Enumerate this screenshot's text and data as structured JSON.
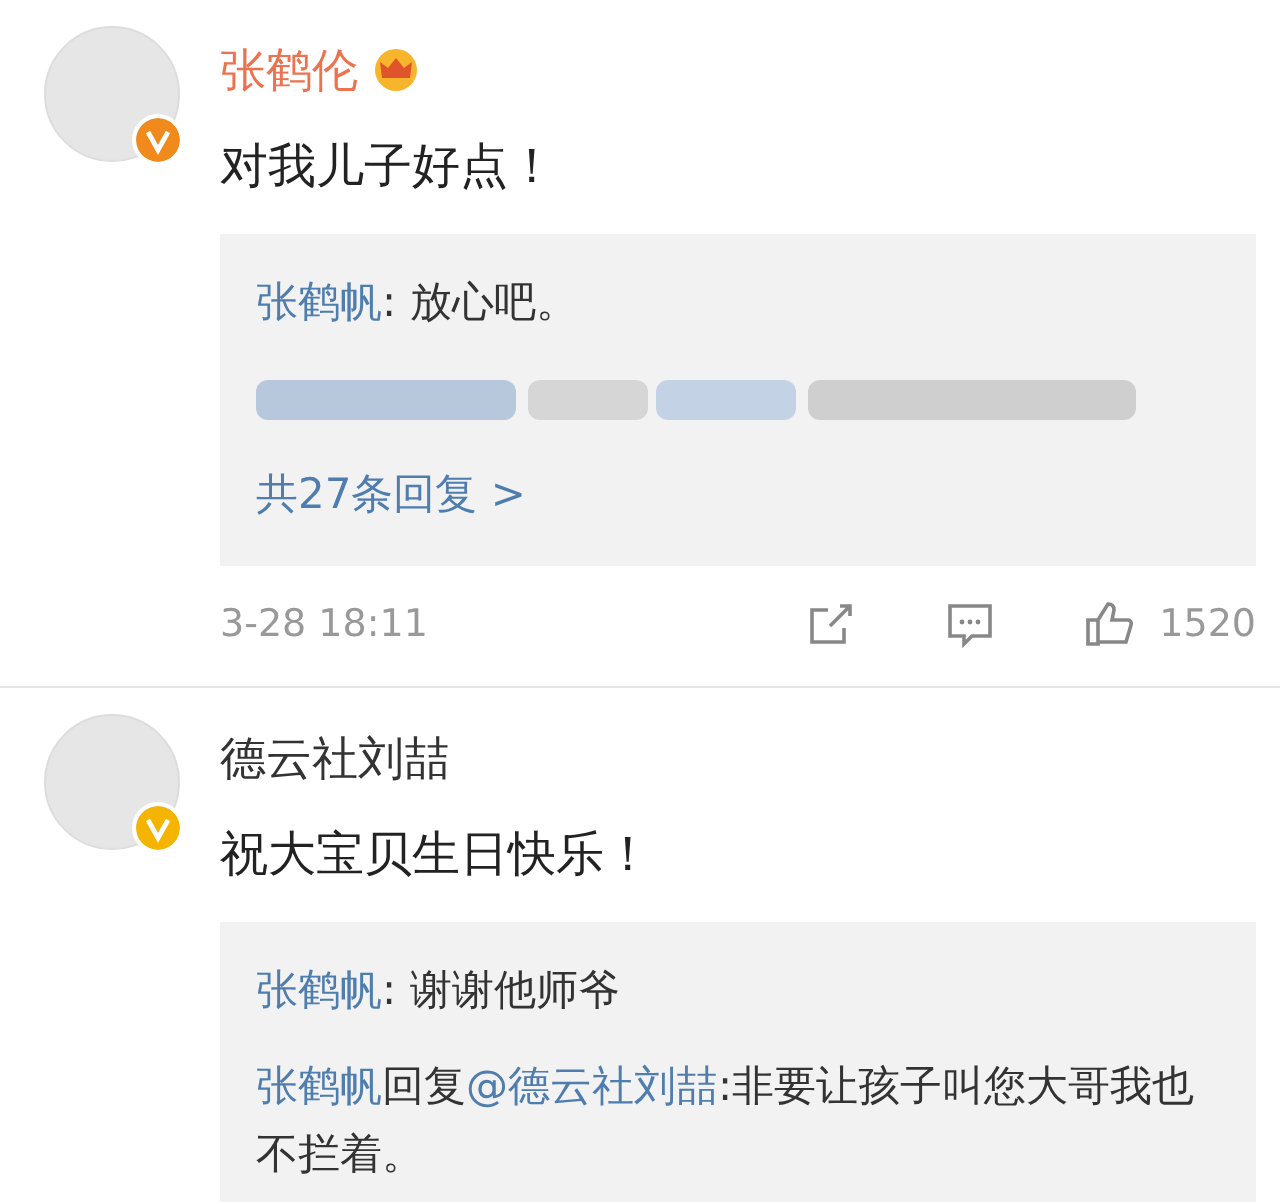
{
  "comments": [
    {
      "author": "张鹤伦",
      "vip": true,
      "color": "#f08a1c",
      "text": "对我儿子好点！",
      "replies": [
        {
          "kind": "reply",
          "author": "张鹤帆",
          "text": ": 放心吧。"
        },
        {
          "kind": "blurred"
        }
      ],
      "more": "共27条回复 >",
      "time": "3-28 18:11",
      "likes": "1520"
    },
    {
      "author": "德云社刘喆",
      "vip": false,
      "color": "#f5b400",
      "text": "祝大宝贝生日快乐！",
      "replies": [
        {
          "kind": "reply",
          "author": "张鹤帆",
          "text": ": 谢谢他师爷"
        },
        {
          "kind": "reply",
          "author": "张鹤帆",
          "prefix": "回复",
          "mention": "@德云社刘喆",
          "text": ":非要让孩子叫您大哥我也不拦着。"
        }
      ]
    }
  ]
}
